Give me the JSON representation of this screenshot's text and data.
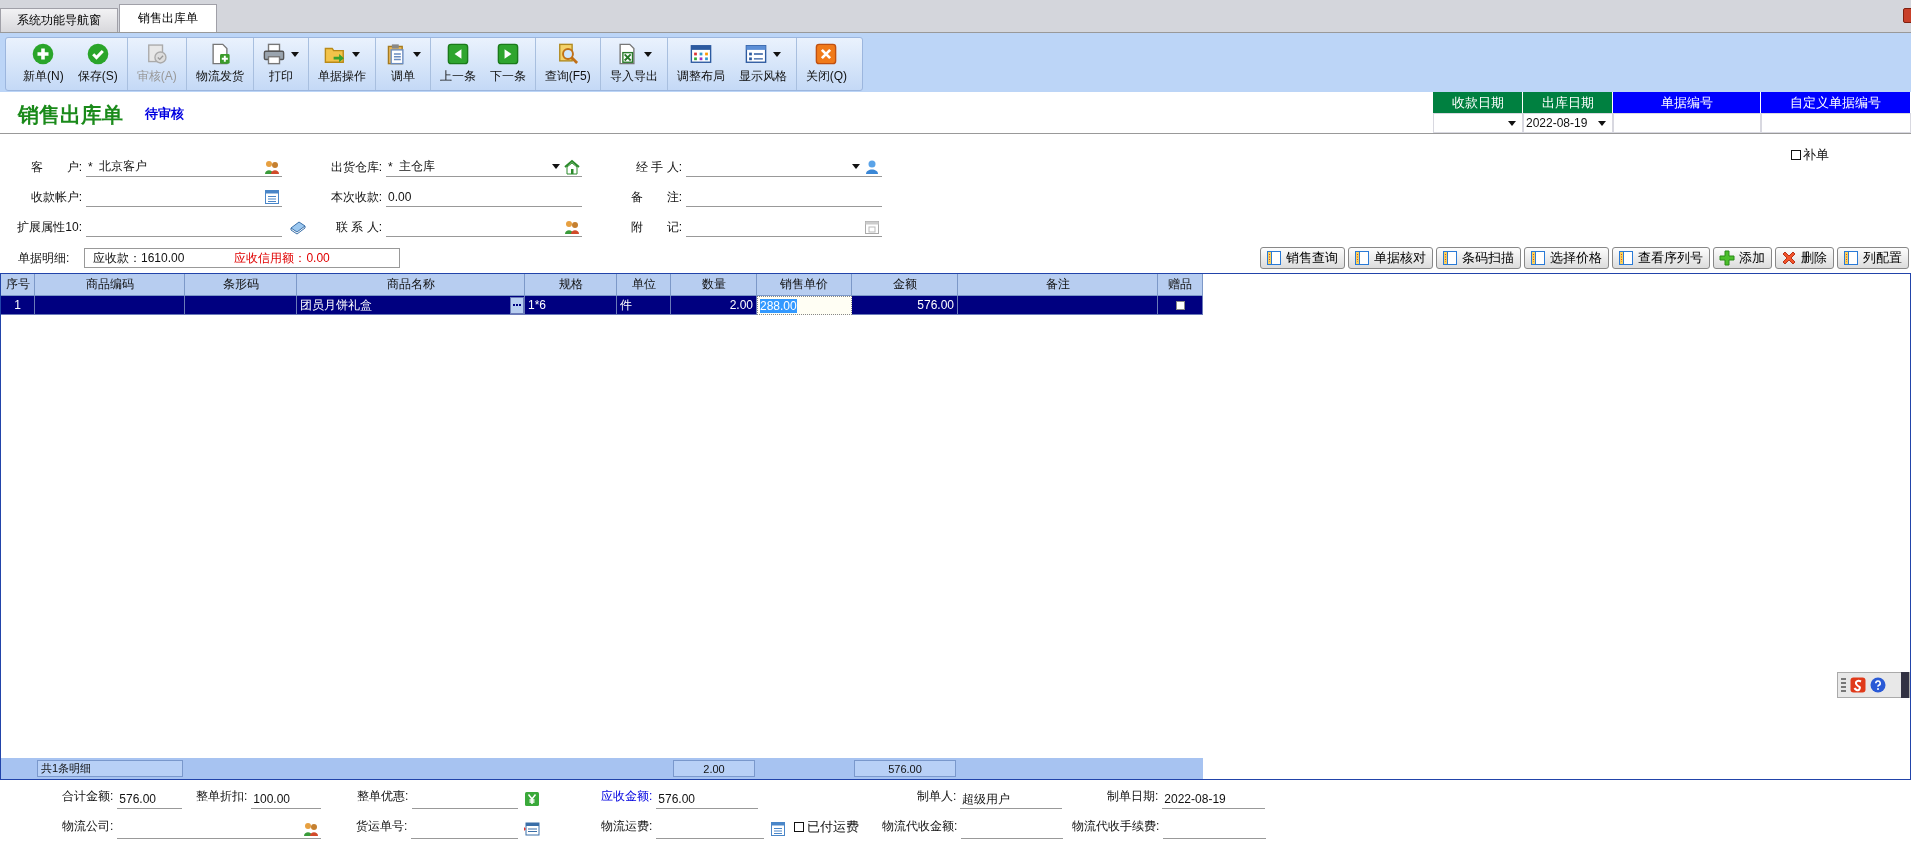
{
  "tabs": [
    {
      "label": "系统功能导航窗",
      "selected": false
    },
    {
      "label": "销售出库单",
      "selected": true
    }
  ],
  "toolbar_groups": [
    [
      {
        "label": "新单(N)",
        "disabled": false,
        "dropdown": false
      },
      {
        "label": "保存(S)",
        "disabled": false,
        "dropdown": false
      }
    ],
    [
      {
        "label": "审核(A)",
        "disabled": true,
        "dropdown": false
      }
    ],
    [
      {
        "label": "物流发货",
        "disabled": false,
        "dropdown": false
      }
    ],
    [
      {
        "label": "打印",
        "disabled": false,
        "dropdown": true
      }
    ],
    [
      {
        "label": "单据操作",
        "disabled": false,
        "dropdown": true
      }
    ],
    [
      {
        "label": "调单",
        "disabled": false,
        "dropdown": true
      }
    ],
    [
      {
        "label": "上一条",
        "disabled": false,
        "dropdown": false
      },
      {
        "label": "下一条",
        "disabled": false,
        "dropdown": false
      }
    ],
    [
      {
        "label": "查询(F5)",
        "disabled": false,
        "dropdown": false
      }
    ],
    [
      {
        "label": "导入导出",
        "disabled": false,
        "dropdown": true
      }
    ],
    [
      {
        "label": "调整布局",
        "disabled": false,
        "dropdown": false
      },
      {
        "label": "显示风格",
        "disabled": false,
        "dropdown": true
      }
    ],
    [
      {
        "label": "关闭(Q)",
        "disabled": false,
        "dropdown": false
      }
    ]
  ],
  "document": {
    "title": "销售出库单",
    "status": "待审核"
  },
  "header_fields": [
    {
      "label": "收款日期",
      "color": "#008040",
      "dropdown": true
    },
    {
      "label": "出库日期",
      "color": "#008040",
      "value": "2022-08-19",
      "dropdown": true
    },
    {
      "label": "单据编号",
      "color": "#0000ff",
      "dropdown": false
    },
    {
      "label": "自定义单据编号",
      "color": "#0000ff",
      "dropdown": false
    }
  ],
  "supplement": {
    "label": "补单",
    "checked": false
  },
  "form_rows": [
    [
      {
        "label": "客　　户:",
        "prefix": "*",
        "value": "北京客户",
        "dropdown": false
      },
      {
        "label": "出货仓库:",
        "prefix": "*",
        "value": "主仓库",
        "dropdown": true
      },
      {
        "label": "经 手 人:",
        "dropdown": true
      }
    ],
    [
      {
        "label": "收款帐户:",
        "dropdown": false
      },
      {
        "label": "本次收款:",
        "value": "0.00",
        "dropdown": false
      },
      {
        "label": "备　　注:",
        "dropdown": false
      }
    ],
    [
      {
        "label": "扩展属性10:",
        "dropdown": false
      },
      {
        "label": "联 系 人:",
        "dropdown": false
      },
      {
        "label": "附　　记:",
        "dropdown": false
      }
    ]
  ],
  "detail": {
    "label": "单据明细:",
    "receivable": "应收款：1610.00",
    "credit": "应收信用额：0.00"
  },
  "action_buttons": [
    "销售查询",
    "单据核对",
    "条码扫描",
    "选择价格",
    "查看序列号",
    "添加",
    "删除",
    "列配置"
  ],
  "grid": {
    "columns": [
      {
        "label": "序号",
        "kind": "index"
      },
      {
        "label": "商品编码",
        "kind": "text"
      },
      {
        "label": "条形码",
        "kind": "text"
      },
      {
        "label": "商品名称",
        "kind": "text",
        "lookup": true
      },
      {
        "label": "规格",
        "kind": "text"
      },
      {
        "label": "单位",
        "kind": "text"
      },
      {
        "label": "数量",
        "kind": "number"
      },
      {
        "label": "销售单价",
        "kind": "number",
        "focused": true
      },
      {
        "label": "金额",
        "kind": "number"
      },
      {
        "label": "备注",
        "kind": "text"
      },
      {
        "label": "赠品",
        "kind": "checkbox"
      }
    ],
    "rows": [
      {
        "selected": true,
        "gift": false,
        "cells": [
          "1",
          null,
          null,
          "团员月饼礼盒",
          "1*6",
          "件",
          "2.00",
          "288.00",
          "576.00",
          null
        ]
      }
    ],
    "summary": {
      "label": "共1条明细",
      "quantity": "2.00",
      "amount": "576.00"
    }
  },
  "footer_rows": [
    [
      {
        "kind": "field",
        "label": "合计金额:",
        "value": "576.00",
        "highlight": false
      },
      {
        "kind": "field",
        "label": "整单折扣:",
        "value": "100.00",
        "highlight": false
      },
      {
        "kind": "field",
        "label": "整单优惠:",
        "highlight": false
      },
      {
        "kind": "field",
        "label": "应收金额:",
        "value": "576.00",
        "highlight": true
      },
      {
        "kind": "field",
        "label": "制单人:",
        "value": "超级用户",
        "highlight": false
      },
      {
        "kind": "field",
        "label": "制单日期:",
        "value": "2022-08-19",
        "highlight": false
      }
    ],
    [
      {
        "kind": "field",
        "label": "物流公司:",
        "highlight": false
      },
      {
        "kind": "field",
        "label": "货运单号:",
        "highlight": false
      },
      {
        "kind": "field",
        "label": "物流运费:",
        "highlight": false
      },
      {
        "kind": "checkbox",
        "label": "已付运费",
        "checked": false
      },
      {
        "kind": "field",
        "label": "物流代收金额:",
        "highlight": false
      },
      {
        "kind": "field",
        "label": "物流代收手续费:",
        "highlight": false
      }
    ]
  ]
}
